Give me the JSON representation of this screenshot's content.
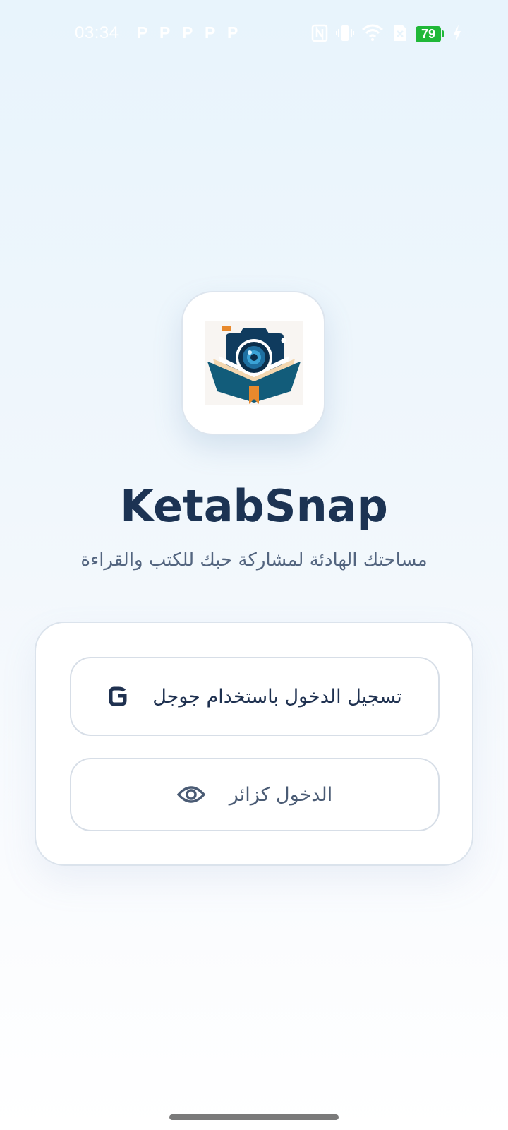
{
  "status_bar": {
    "time": "03:34",
    "notification_icons": [
      "P",
      "P",
      "P",
      "P",
      "P"
    ],
    "battery_level": "79",
    "icons": [
      "nfc-icon",
      "vibrate-icon",
      "wifi-icon",
      "sim-off-icon",
      "battery-icon",
      "charging-icon"
    ]
  },
  "app": {
    "title": "KetabSnap",
    "subtitle": "مساحتك الهادئة لمشاركة حبك للكتب والقراءة"
  },
  "login": {
    "google_label": "تسجيل الدخول باستخدام جوجل",
    "guest_label": "الدخول كزائر"
  },
  "colors": {
    "title": "#1c3353",
    "battery": "#20b838",
    "logo_navy": "#0f3b5e",
    "logo_teal": "#125c7a",
    "logo_orange": "#e8892c"
  }
}
